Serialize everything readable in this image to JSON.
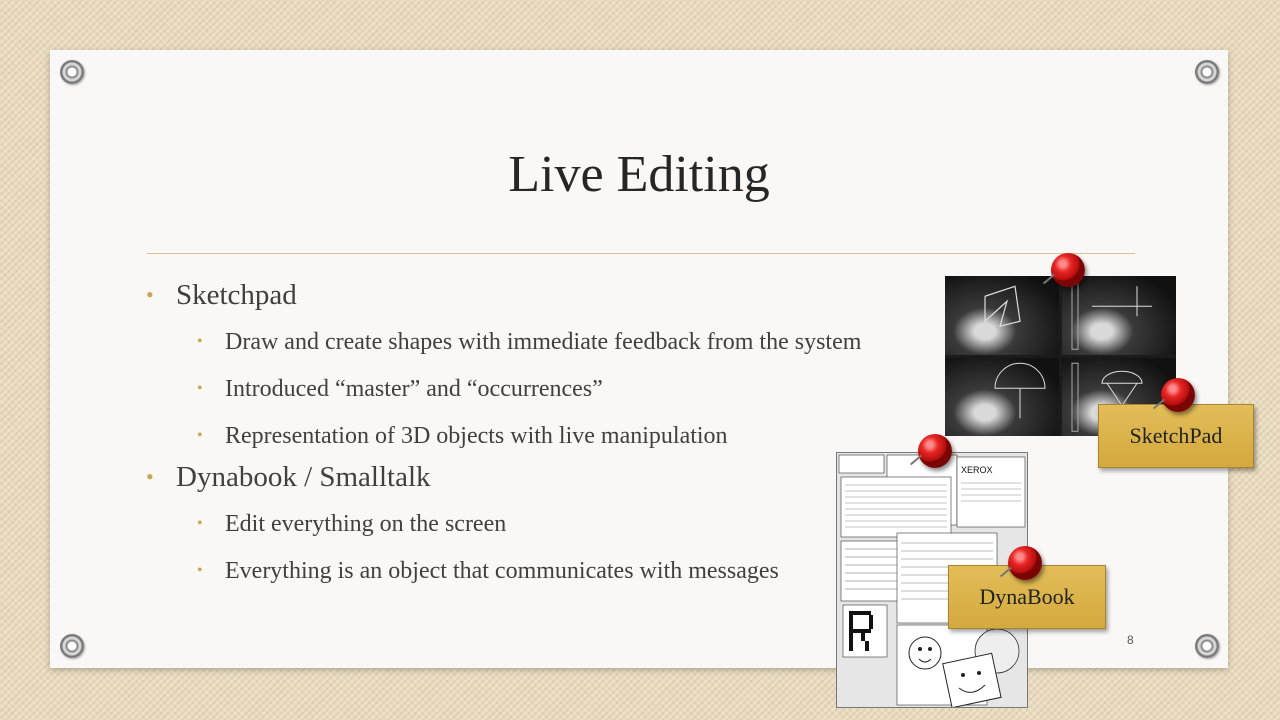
{
  "slide": {
    "title": "Live Editing",
    "page_number": "8",
    "bullets": [
      {
        "level": 1,
        "text": "Sketchpad"
      },
      {
        "level": 2,
        "text": "Draw and create shapes with immediate feedback from the system"
      },
      {
        "level": 2,
        "text": "Introduced “master” and “occurrences”"
      },
      {
        "level": 2,
        "text": "Representation of  3D objects with live manipulation"
      },
      {
        "level": 1,
        "text": "Dynabook / Smalltalk"
      },
      {
        "level": 2,
        "text": "Edit everything on the screen"
      },
      {
        "level": 2,
        "text": "Everything is an object that communicates with messages"
      }
    ]
  },
  "images": {
    "sketchpad_label": "SketchPad",
    "dynabook_label": "DynaBook",
    "dynabook_screen_text": "XEROX"
  },
  "colors": {
    "bullet_accent": "#c9a64e",
    "label_gold": "#d9b24a",
    "pin_red": "#e82626"
  }
}
